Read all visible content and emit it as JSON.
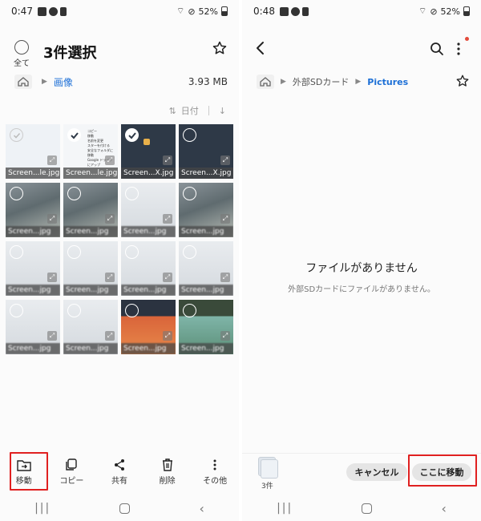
{
  "left": {
    "status": {
      "time": "0:47",
      "battery": "52%"
    },
    "select_all_label": "全て",
    "title": "3件選択",
    "breadcrumb": {
      "folder": "画像",
      "size": "3.93 MB"
    },
    "sort_label": "日付",
    "tiles": [
      {
        "caption": "Screen...le.jpg",
        "state": "unchecked-dark",
        "style": "light"
      },
      {
        "caption": "Screen...le.jpg",
        "state": "checked",
        "style": "menu"
      },
      {
        "caption": "Screen...X.jpg",
        "state": "checked",
        "style": "dark"
      },
      {
        "caption": "Screen...X.jpg",
        "state": "unchecked",
        "style": "dark"
      },
      {
        "caption": "Screen...jpg",
        "state": "unchecked",
        "style": "blur-sky"
      },
      {
        "caption": "Screen...jpg",
        "state": "unchecked",
        "style": "blur-sky"
      },
      {
        "caption": "Screen...jpg",
        "state": "unchecked",
        "style": "blur-light"
      },
      {
        "caption": "Screen...jpg",
        "state": "unchecked",
        "style": "blur-sky"
      },
      {
        "caption": "Screen...jpg",
        "state": "unchecked",
        "style": "blur-light"
      },
      {
        "caption": "Screen...jpg",
        "state": "unchecked",
        "style": "blur-light"
      },
      {
        "caption": "Screen...jpg",
        "state": "unchecked",
        "style": "blur-light"
      },
      {
        "caption": "Screen...jpg",
        "state": "unchecked",
        "style": "blur-light"
      },
      {
        "caption": "Screen...jpg",
        "state": "unchecked",
        "style": "blur-light"
      },
      {
        "caption": "Screen...jpg",
        "state": "unchecked",
        "style": "blur-light"
      },
      {
        "caption": "Screen...jpg",
        "state": "unchecked",
        "style": "blur-orange"
      },
      {
        "caption": "Screen...jpg",
        "state": "unchecked",
        "style": "blur-green"
      }
    ],
    "mini_menu": [
      "コピー",
      "移動",
      "名前を変更",
      "スターを付ける",
      "安全なフォルダに移動",
      "Google ドライブにアップ"
    ],
    "actions": [
      {
        "label": "移動",
        "icon": "move-icon"
      },
      {
        "label": "コピー",
        "icon": "copy-icon"
      },
      {
        "label": "共有",
        "icon": "share-icon"
      },
      {
        "label": "削除",
        "icon": "delete-icon"
      },
      {
        "label": "その他",
        "icon": "more-icon"
      }
    ]
  },
  "right": {
    "status": {
      "time": "0:48",
      "battery": "52%"
    },
    "breadcrumb": {
      "parent": "外部SDカード",
      "current": "Pictures"
    },
    "empty_title": "ファイルがありません",
    "empty_subtitle": "外部SDカードにファイルがありません。",
    "item_count": "3件",
    "cancel_label": "キャンセル",
    "move_here_label": "ここに移動"
  },
  "colors": {
    "accent": "#1c6fd6",
    "highlight": "#e02020"
  }
}
